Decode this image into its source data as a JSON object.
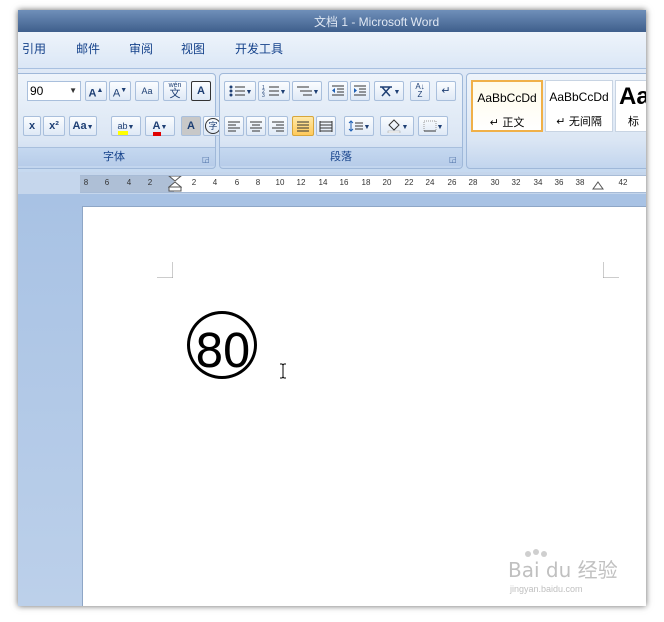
{
  "window": {
    "title": "文档 1 - Microsoft Word"
  },
  "menu": {
    "tabs": [
      "引用",
      "邮件",
      "审阅",
      "视图",
      "开发工具"
    ]
  },
  "ribbon": {
    "font_group": {
      "label": "字体",
      "font_size": "90",
      "grow_font": "A",
      "shrink_font": "A",
      "clear_format": "Aa",
      "phonetic_guide": "wén",
      "phonetic_char": "文",
      "char_border": "A",
      "subscript": "x",
      "superscript": "x²",
      "change_case": "Aa",
      "highlight": "ab",
      "font_color": "A",
      "char_shading": "A",
      "enclose_char": "字"
    },
    "paragraph_group": {
      "label": "段落"
    },
    "styles": [
      {
        "sample": "AaBbCcDd",
        "name": "↵ 正文"
      },
      {
        "sample": "AaBbCcDd",
        "name": "↵ 无间隔"
      },
      {
        "sample": "Aa",
        "name": "标"
      }
    ]
  },
  "ruler": {
    "labels": [
      "8",
      "6",
      "4",
      "2",
      "2",
      "4",
      "6",
      "8",
      "10",
      "12",
      "14",
      "16",
      "18",
      "20",
      "22",
      "24",
      "26",
      "28",
      "30",
      "32",
      "34",
      "36",
      "38",
      "42"
    ]
  },
  "document": {
    "enclosed_text": "80"
  },
  "watermark": {
    "text": "Bai du 经验",
    "sub": "jingyan.baidu.com"
  },
  "colors": {
    "ribbon_bg": "#dfe9f6",
    "accent": "#15428b",
    "selected_style_border": "#f0b048",
    "font_color_bar": "#e00000",
    "highlight_bar": "#ffff00"
  }
}
